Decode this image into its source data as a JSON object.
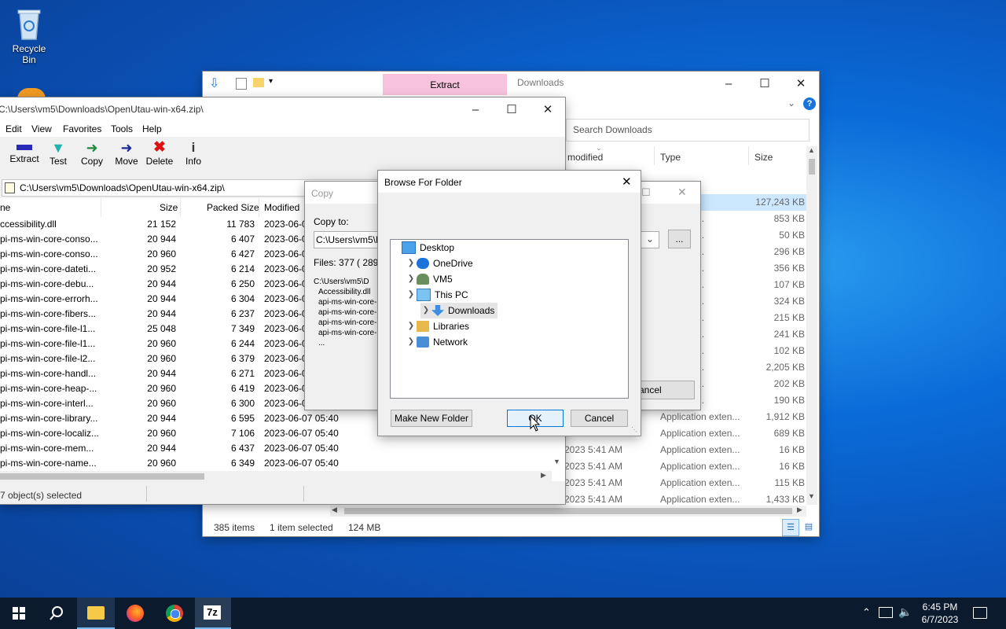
{
  "desktop": {
    "recycle_bin_label": "Recycle Bin"
  },
  "explorer": {
    "ribbon_tab_extract": "Extract",
    "title": "Downloads",
    "search_placeholder": "Search Downloads",
    "columns": {
      "modified": "modified",
      "type": "Type",
      "size": "Size"
    },
    "rows": [
      {
        "time": "",
        "type": "e",
        "size": "127,243 KB"
      },
      {
        "time": "",
        "type": "on exten...",
        "size": "853 KB"
      },
      {
        "time": "",
        "type": "on exten...",
        "size": "50 KB"
      },
      {
        "time": "",
        "type": "on exten...",
        "size": "296 KB"
      },
      {
        "time": "",
        "type": "on exten...",
        "size": "356 KB"
      },
      {
        "time": "",
        "type": "on exten...",
        "size": "107 KB"
      },
      {
        "time": "",
        "type": "on exten...",
        "size": "324 KB"
      },
      {
        "time": "",
        "type": "on exten...",
        "size": "215 KB"
      },
      {
        "time": "",
        "type": "on exten...",
        "size": "241 KB"
      },
      {
        "time": "",
        "type": "on exten...",
        "size": "102 KB"
      },
      {
        "time": "",
        "type": "on exten...",
        "size": "2,205 KB"
      },
      {
        "time": "",
        "type": "on exten...",
        "size": "202 KB"
      },
      {
        "time": "",
        "type": "on exten...",
        "size": "190 KB"
      },
      {
        "time": "",
        "type": "Application exten...",
        "size": "1,912 KB"
      },
      {
        "time": "",
        "type": "Application exten...",
        "size": "689 KB"
      },
      {
        "time": "2023 5:41 AM",
        "type": "Application exten...",
        "size": "16 KB"
      },
      {
        "time": "2023 5:41 AM",
        "type": "Application exten...",
        "size": "16 KB"
      },
      {
        "time": "2023 5:41 AM",
        "type": "Application exten...",
        "size": "115 KB"
      },
      {
        "time": "2023 5:41 AM",
        "type": "Application exten...",
        "size": "1,433 KB"
      }
    ],
    "status_items": "385 items",
    "status_selected": "1 item selected",
    "status_size": "124 MB"
  },
  "sevenzip": {
    "title": "C:\\Users\\vm5\\Downloads\\OpenUtau-win-x64.zip\\",
    "menu": [
      "Edit",
      "View",
      "Favorites",
      "Tools",
      "Help"
    ],
    "toolbar": [
      "Extract",
      "Test",
      "Copy",
      "Move",
      "Delete",
      "Info"
    ],
    "address": "C:\\Users\\vm5\\Downloads\\OpenUtau-win-x64.zip\\",
    "columns": {
      "name": "ne",
      "size": "Size",
      "packed": "Packed Size",
      "modified": "Modified"
    },
    "rows": [
      {
        "name": "ccessibility.dll",
        "size": "21 152",
        "packed": "11 783",
        "modified": "2023-06-0"
      },
      {
        "name": "pi-ms-win-core-conso...",
        "size": "20 944",
        "packed": "6 407",
        "modified": "2023-06-0"
      },
      {
        "name": "pi-ms-win-core-conso...",
        "size": "20 960",
        "packed": "6 427",
        "modified": "2023-06-0"
      },
      {
        "name": "pi-ms-win-core-dateti...",
        "size": "20 952",
        "packed": "6 214",
        "modified": "2023-06-0"
      },
      {
        "name": "pi-ms-win-core-debu...",
        "size": "20 944",
        "packed": "6 250",
        "modified": "2023-06-0"
      },
      {
        "name": "pi-ms-win-core-errorh...",
        "size": "20 944",
        "packed": "6 304",
        "modified": "2023-06-0"
      },
      {
        "name": "pi-ms-win-core-fibers...",
        "size": "20 944",
        "packed": "6 237",
        "modified": "2023-06-0"
      },
      {
        "name": "pi-ms-win-core-file-l1...",
        "size": "25 048",
        "packed": "7 349",
        "modified": "2023-06-0"
      },
      {
        "name": "pi-ms-win-core-file-l1...",
        "size": "20 960",
        "packed": "6 244",
        "modified": "2023-06-0"
      },
      {
        "name": "pi-ms-win-core-file-l2...",
        "size": "20 960",
        "packed": "6 379",
        "modified": "2023-06-0"
      },
      {
        "name": "pi-ms-win-core-handl...",
        "size": "20 944",
        "packed": "6 271",
        "modified": "2023-06-0"
      },
      {
        "name": "pi-ms-win-core-heap-...",
        "size": "20 960",
        "packed": "6 419",
        "modified": "2023-06-0"
      },
      {
        "name": "pi-ms-win-core-interl...",
        "size": "20 960",
        "packed": "6 300",
        "modified": "2023-06-0"
      },
      {
        "name": "pi-ms-win-core-library...",
        "size": "20 944",
        "packed": "6 595",
        "modified": "2023-06-07 05:40"
      },
      {
        "name": "pi-ms-win-core-localiz...",
        "size": "20 960",
        "packed": "7 106",
        "modified": "2023-06-07 05:40"
      },
      {
        "name": "pi-ms-win-core-mem...",
        "size": "20 944",
        "packed": "6 437",
        "modified": "2023-06-07 05:40"
      },
      {
        "name": "pi-ms-win-core-name...",
        "size": "20 960",
        "packed": "6 349",
        "modified": "2023-06-07 05:40"
      }
    ],
    "status": "7 object(s) selected"
  },
  "copy_dialog": {
    "title": "Copy",
    "copy_to_label": "Copy to:",
    "path": "C:\\Users\\vm5\\D",
    "browse_label": "...",
    "files_label": "Files: 377",
    "files_extra": "( 289",
    "list": [
      "C:\\Users\\vm5\\D",
      "Accessibility.dll",
      "api-ms-win-core-",
      "api-ms-win-core-",
      "api-ms-win-core-",
      "api-ms-win-core-",
      "..."
    ],
    "cancel_label": "ancel"
  },
  "browse_dialog": {
    "title": "Browse For Folder",
    "tree": [
      {
        "label": "Desktop",
        "icon": "desktop-icon",
        "level": 0,
        "chevron": false
      },
      {
        "label": "OneDrive",
        "icon": "cloud-icon",
        "level": 1,
        "chevron": true
      },
      {
        "label": "VM5",
        "icon": "user-icon",
        "level": 1,
        "chevron": true
      },
      {
        "label": "This PC",
        "icon": "computer-icon",
        "level": 1,
        "chevron": true
      },
      {
        "label": "Downloads",
        "icon": "download-icon",
        "level": 2,
        "chevron": true,
        "selected": true
      },
      {
        "label": "Libraries",
        "icon": "library-icon",
        "level": 1,
        "chevron": true
      },
      {
        "label": "Network",
        "icon": "network-icon",
        "level": 1,
        "chevron": true
      }
    ],
    "new_folder_label": "Make New Folder",
    "ok_label": "OK",
    "cancel_label": "Cancel"
  },
  "taskbar": {
    "time": "6:45 PM",
    "date": "6/7/2023",
    "zip_app_label": "7z"
  }
}
